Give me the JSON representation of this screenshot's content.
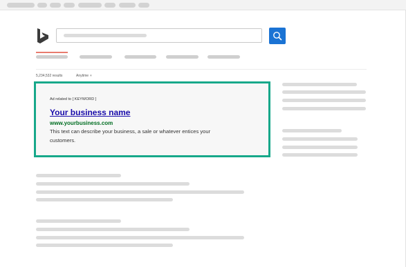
{
  "search": {
    "results_count": "5,234,532 results",
    "time_filter": "Anytime",
    "time_filter_chevron": "▾"
  },
  "ad": {
    "related_label": "Ad related to [ KEYWORD ]",
    "title": "Your business name",
    "url": "www.yourbusiness.com",
    "description": "This text can describe your business, a sale or whatever entices your customers."
  },
  "colors": {
    "ad_border": "#17a88a",
    "ad_title": "#1a0dab",
    "ad_url": "#006d21",
    "search_button": "#1a73d4",
    "active_tab": "#e87b6e"
  },
  "icons": {
    "logo": "bing-logo",
    "search_button": "magnifier-icon"
  }
}
